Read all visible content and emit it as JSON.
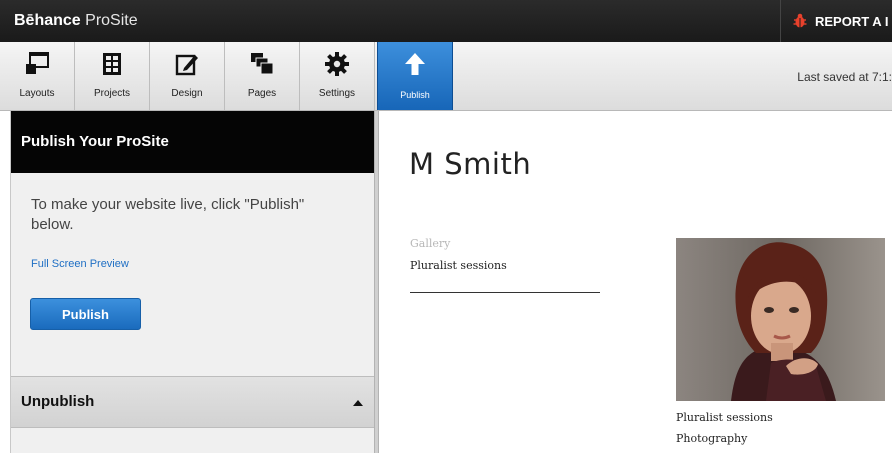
{
  "app": {
    "brand_bold": "Bēhance",
    "brand_light": "ProSite"
  },
  "report": {
    "label": "REPORT A I"
  },
  "toolbar": {
    "items": [
      {
        "label": "Layouts",
        "icon": "layouts-icon"
      },
      {
        "label": "Projects",
        "icon": "projects-icon"
      },
      {
        "label": "Design",
        "icon": "design-icon"
      },
      {
        "label": "Pages",
        "icon": "pages-icon"
      },
      {
        "label": "Settings",
        "icon": "gear-icon"
      }
    ],
    "publish": {
      "label": "Publish",
      "icon": "arrow-up-icon"
    },
    "saved": "Last saved at 7:1:",
    "accent": "#1f72c4"
  },
  "sidebar": {
    "title": "Publish Your ProSite",
    "description": "To make your website live, click \"Publish\" below.",
    "preview_link": "Full Screen Preview",
    "publish_button": "Publish",
    "unpublish": "Unpublish"
  },
  "preview": {
    "site_title": "M Smith",
    "gallery_label": "Gallery",
    "gallery_item": "Pluralist sessions",
    "caption_title": "Pluralist sessions",
    "caption_category": "Photography"
  }
}
